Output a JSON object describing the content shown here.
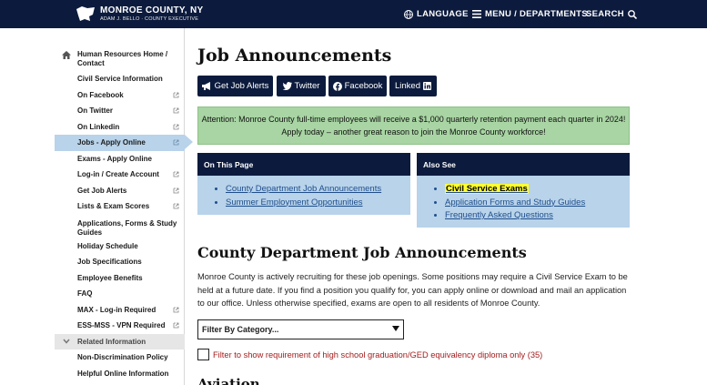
{
  "header": {
    "title": "MONROE COUNTY, NY",
    "subtitle": "ADAM J. BELLO · COUNTY EXECUTIVE",
    "language_label": "LANGUAGE",
    "menu_label": "MENU / DEPARTMENTS",
    "search_label": "SEARCH"
  },
  "sidebar": {
    "home": "Human Resources Home / Contact",
    "items": [
      {
        "label": "Civil Service Information",
        "external": false
      },
      {
        "label": "On Facebook",
        "external": true
      },
      {
        "label": "On Twitter",
        "external": true
      },
      {
        "label": "On Linkedin",
        "external": true
      },
      {
        "label": "Jobs - Apply Online",
        "external": true,
        "active": true
      },
      {
        "label": "Exams - Apply Online",
        "external": false
      },
      {
        "label": "Log-in / Create Account",
        "external": true
      },
      {
        "label": "Get Job Alerts",
        "external": true
      },
      {
        "label": "Lists & Exam Scores",
        "external": true
      },
      {
        "label": "Applications, Forms & Study Guides",
        "external": false
      },
      {
        "label": "Holiday Schedule",
        "external": false
      },
      {
        "label": "Job Specifications",
        "external": false
      },
      {
        "label": "Employee Benefits",
        "external": false
      },
      {
        "label": "FAQ",
        "external": false
      },
      {
        "label": "MAX - Log-in Required",
        "external": true
      },
      {
        "label": "ESS-MSS - VPN Required",
        "external": true
      }
    ],
    "related_label": "Related Information",
    "related_items": [
      "Non-Discrimination Policy",
      "Helpful Online Information"
    ]
  },
  "main": {
    "title": "Job Announcements",
    "buttons": {
      "alerts": "Get Job Alerts",
      "twitter": "Twitter",
      "facebook": "Facebook",
      "linkedin": "Linked"
    },
    "alert": "Attention: Monroe County full-time employees will receive a $1,000 quarterly retention payment each quarter in 2024! Apply today – another great reason to join the Monroe County workforce!",
    "on_this_page": {
      "heading": "On This Page",
      "links": [
        "County Department Job Announcements",
        "Summer Employment Opportunities"
      ]
    },
    "also_see": {
      "heading": "Also See",
      "links": [
        "Civil Service Exams",
        "Application Forms and Study Guides",
        "Frequently Asked Questions"
      ]
    },
    "section_title": "County Department Job Announcements",
    "body": "Monroe County is actively recruiting for these job openings. Some positions may require a Civil Service Exam to be held at a future date. If you find a position you qualify for, you can apply online or download and mail an application to our office. Unless otherwise specified, exams are open to all residents of Monroe County.",
    "filter_placeholder": "Filter By Category...",
    "checkbox_label": "Filter to show requirement of high school graduation/GED equivalency diploma only (35)",
    "next_heading": "Aviation"
  },
  "colors": {
    "navy": "#0c1b3d",
    "light_blue": "#b8d3ea",
    "alert_green": "#a8d5a3",
    "link_blue": "#1f4e8c",
    "highlight": "#ffff33",
    "filter_red": "#a41d1d"
  }
}
